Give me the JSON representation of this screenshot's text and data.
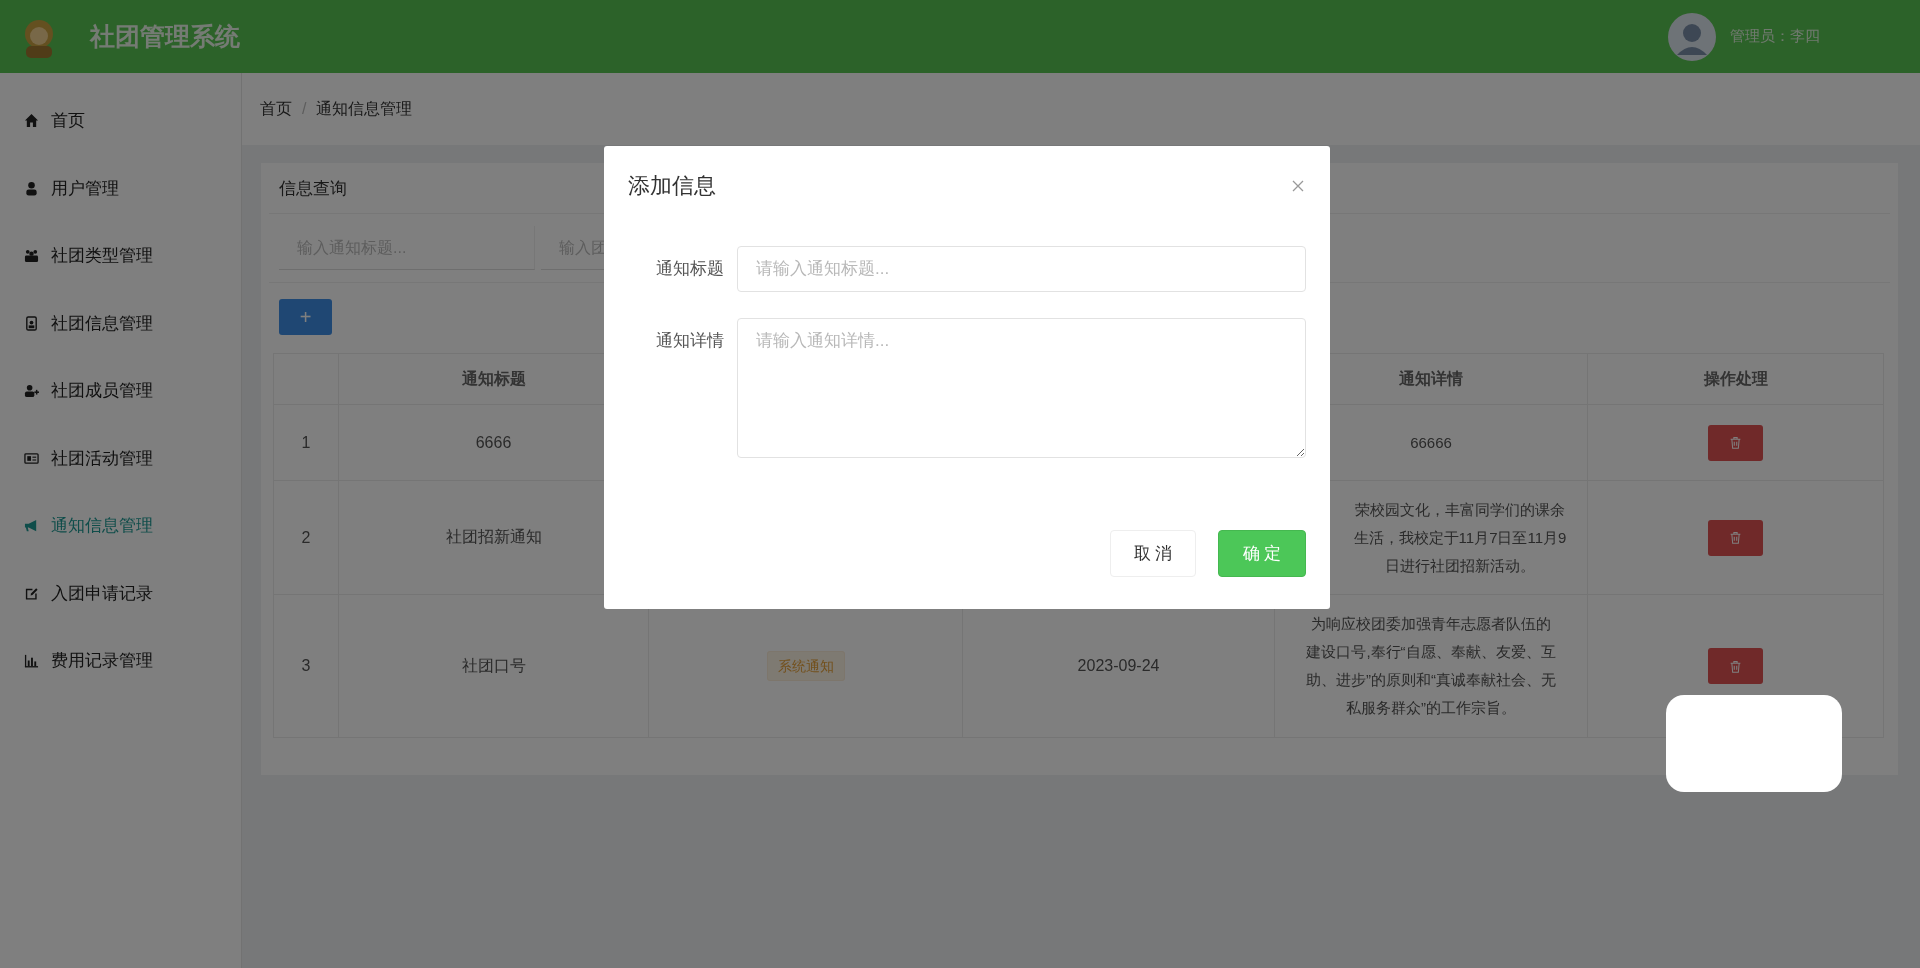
{
  "header": {
    "title": "社团管理系统",
    "user": "管理员：李四"
  },
  "sidebar": {
    "items": [
      {
        "label": "首页",
        "selected": false
      },
      {
        "label": "用户管理",
        "selected": false
      },
      {
        "label": "社团类型管理",
        "selected": false
      },
      {
        "label": "社团信息管理",
        "selected": false
      },
      {
        "label": "社团成员管理",
        "selected": false
      },
      {
        "label": "社团活动管理",
        "selected": false
      },
      {
        "label": "通知信息管理",
        "selected": true
      },
      {
        "label": "入团申请记录",
        "selected": false
      },
      {
        "label": "费用记录管理",
        "selected": false
      }
    ]
  },
  "breadcrumb": {
    "items": [
      "首页",
      "通知信息管理"
    ],
    "separator": "/"
  },
  "query_panel": {
    "title": "信息查询",
    "filters": [
      {
        "placeholder": "输入通知标题..."
      },
      {
        "placeholder": "输入团"
      }
    ],
    "add_button": "+"
  },
  "table": {
    "headers": {
      "title": "通知标题",
      "detail": "通知详情",
      "actions": "操作处理"
    },
    "rows": [
      {
        "index": "1",
        "title": "6666",
        "detail": [
          "66666"
        ]
      },
      {
        "index": "2",
        "title": "社团招新通知",
        "detail": [
          "荣校园文化，丰富同学们的课余",
          "生活，我校定于11月7日至11月9",
          "日进行社团招新活动。"
        ]
      },
      {
        "index": "3",
        "title": "社团口号",
        "type": "系统通知",
        "date": "2023-09-24",
        "detail": [
          "为响应校团委加强青年志愿者队伍的",
          "建设口号,奉行“自愿、奉献、友爱、互",
          "助、进步”的原则和“真诚奉献社会、无",
          "私服务群众”的工作宗旨。"
        ]
      }
    ]
  },
  "modal": {
    "title": "添加信息",
    "fields": [
      {
        "label": "通知标题",
        "placeholder": "请输入通知标题...",
        "kind": "input"
      },
      {
        "label": "通知详情",
        "placeholder": "请输入通知详情...",
        "kind": "textarea"
      }
    ],
    "buttons": [
      {
        "label": "取 消",
        "kind": "default"
      },
      {
        "label": "确 定",
        "kind": "primary"
      }
    ]
  }
}
